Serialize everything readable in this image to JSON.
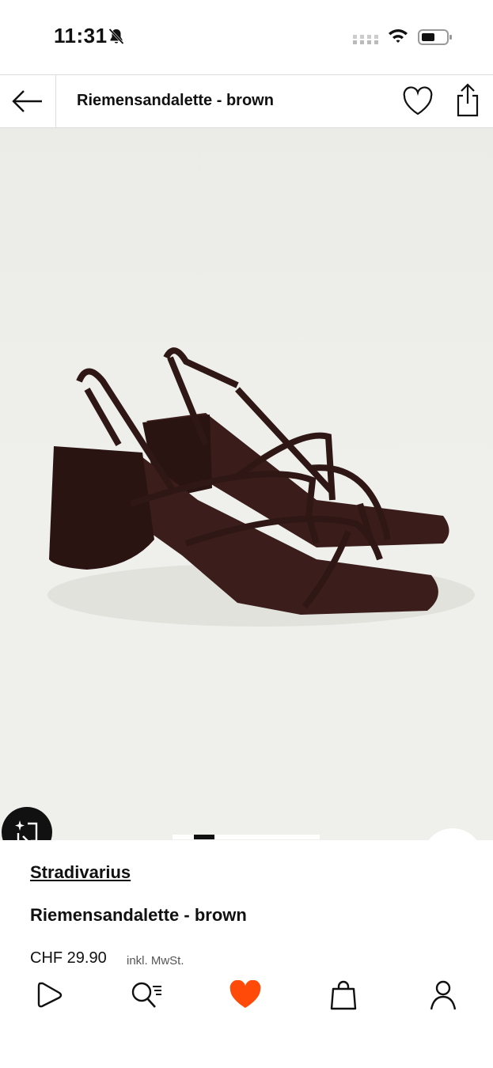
{
  "status_bar": {
    "time": "11:31"
  },
  "header": {
    "title": "Riemensandalette - brown"
  },
  "product": {
    "brand": "Stradivarius",
    "name": "Riemensandalette - brown",
    "price": "CHF 29.90",
    "tax_note": "inkl. MwSt."
  },
  "gallery": {
    "current_image": 1
  },
  "colors": {
    "accent": "#ff4a0a",
    "shoe": "#2e1714",
    "background": "#efefeb"
  },
  "bottom_nav": {
    "items": [
      "play-icon",
      "search-icon",
      "heart-icon",
      "bag-icon",
      "profile-icon"
    ],
    "active": "heart-icon"
  }
}
